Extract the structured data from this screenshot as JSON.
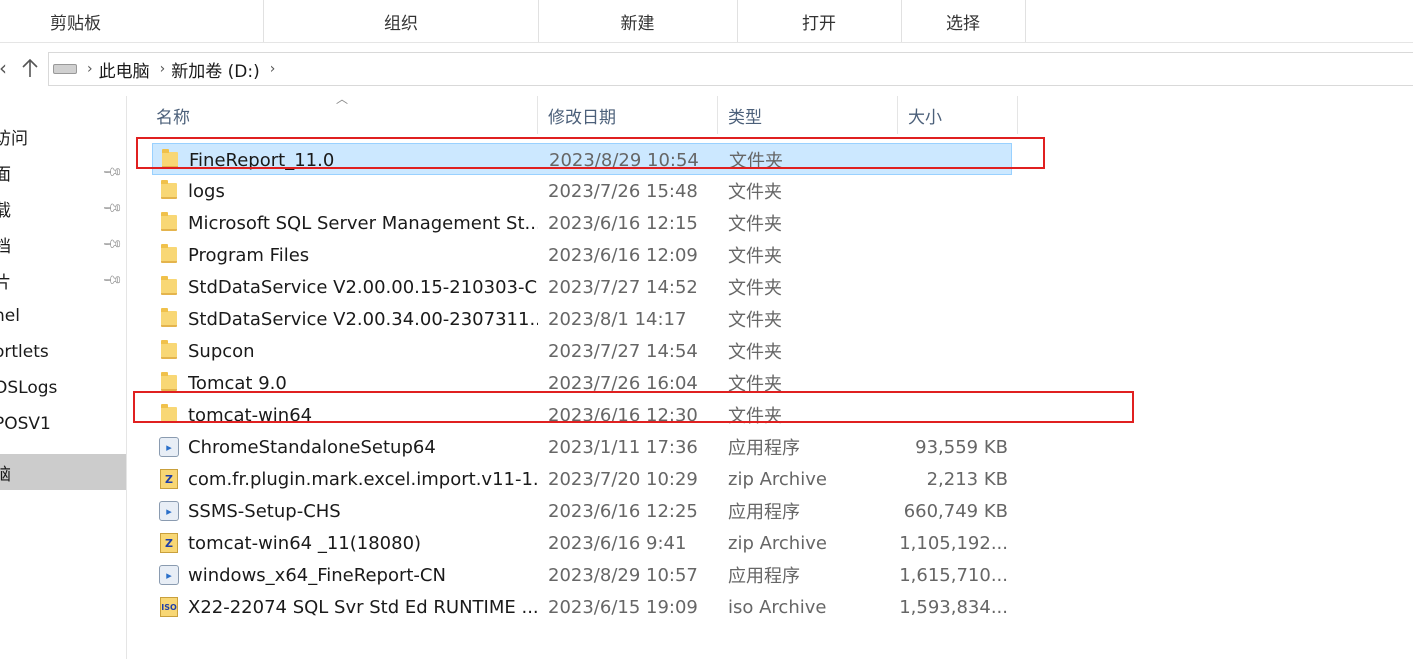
{
  "ribbon": {
    "groups": [
      "剪贴板",
      "组织",
      "新建",
      "打开",
      "选择"
    ]
  },
  "nav": {
    "back_icon": "chevron-left-icon",
    "up_icon": "arrow-up-icon",
    "breadcrumb": [
      "此电脑",
      "新加卷 (D:)"
    ]
  },
  "navpane": {
    "items": [
      {
        "label": "访问",
        "pinned": false
      },
      {
        "label": "面",
        "pinned": true
      },
      {
        "label": "载",
        "pinned": true
      },
      {
        "label": "档",
        "pinned": true
      },
      {
        "label": "片",
        "pinned": true
      },
      {
        "label": "nel",
        "pinned": false
      },
      {
        "label": "ortlets",
        "pinned": false
      },
      {
        "label": "OSLogs",
        "pinned": false
      },
      {
        "label": "POSV1",
        "pinned": false
      },
      {
        "label": "脑",
        "pinned": false,
        "selected": true
      }
    ]
  },
  "columns": {
    "name": "名称",
    "date": "修改日期",
    "type": "类型",
    "size": "大小"
  },
  "files": [
    {
      "icon": "folder",
      "name": "FineReport_11.0",
      "date": "2023/8/29 10:54",
      "type": "文件夹",
      "size": "",
      "selected": true
    },
    {
      "icon": "folder",
      "name": "logs",
      "date": "2023/7/26 15:48",
      "type": "文件夹",
      "size": ""
    },
    {
      "icon": "folder",
      "name": "Microsoft SQL Server Management St...",
      "date": "2023/6/16 12:15",
      "type": "文件夹",
      "size": ""
    },
    {
      "icon": "folder",
      "name": "Program Files",
      "date": "2023/6/16 12:09",
      "type": "文件夹",
      "size": ""
    },
    {
      "icon": "folder",
      "name": "StdDataService V2.00.00.15-210303-C",
      "date": "2023/7/27 14:52",
      "type": "文件夹",
      "size": ""
    },
    {
      "icon": "folder",
      "name": "StdDataService V2.00.34.00-2307311...",
      "date": "2023/8/1 14:17",
      "type": "文件夹",
      "size": ""
    },
    {
      "icon": "folder",
      "name": "Supcon",
      "date": "2023/7/27 14:54",
      "type": "文件夹",
      "size": ""
    },
    {
      "icon": "folder",
      "name": "Tomcat 9.0",
      "date": "2023/7/26 16:04",
      "type": "文件夹",
      "size": ""
    },
    {
      "icon": "folder",
      "name": "tomcat-win64",
      "date": "2023/6/16 12:30",
      "type": "文件夹",
      "size": ""
    },
    {
      "icon": "app",
      "name": "ChromeStandaloneSetup64",
      "date": "2023/1/11 17:36",
      "type": "应用程序",
      "size": "93,559 KB"
    },
    {
      "icon": "zip",
      "name": "com.fr.plugin.mark.excel.import.v11-1...",
      "date": "2023/7/20 10:29",
      "type": "zip Archive",
      "size": "2,213 KB"
    },
    {
      "icon": "app",
      "name": "SSMS-Setup-CHS",
      "date": "2023/6/16 12:25",
      "type": "应用程序",
      "size": "660,749 KB"
    },
    {
      "icon": "zip",
      "name": "tomcat-win64 _11(18080)",
      "date": "2023/6/16 9:41",
      "type": "zip Archive",
      "size": "1,105,192..."
    },
    {
      "icon": "app",
      "name": "windows_x64_FineReport-CN",
      "date": "2023/8/29 10:57",
      "type": "应用程序",
      "size": "1,615,710..."
    },
    {
      "icon": "iso",
      "name": "X22-22074 SQL Svr Std Ed RUNTIME ...",
      "date": "2023/6/15 19:09",
      "type": "iso Archive",
      "size": "1,593,834..."
    }
  ],
  "icons": {
    "folder": "folder-icon",
    "app": "application-icon",
    "zip": "zip-archive-icon",
    "iso": "iso-archive-icon"
  },
  "colors": {
    "selection": "#cce8ff",
    "annotation": "#e02020"
  }
}
